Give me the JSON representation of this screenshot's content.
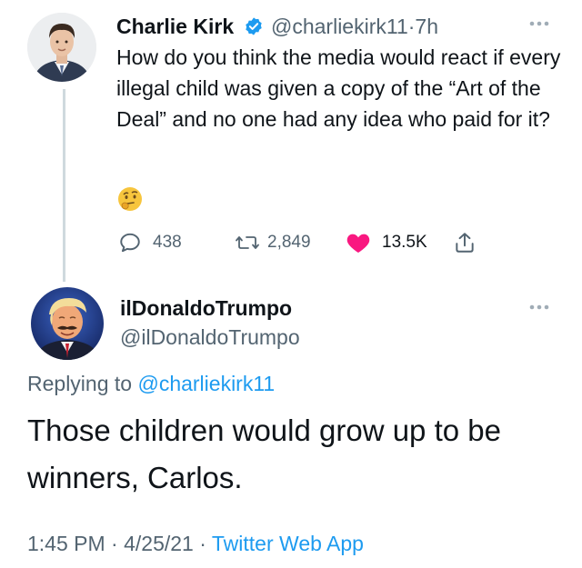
{
  "parent_tweet": {
    "author_name": "Charlie Kirk",
    "author_handle": "@charliekirk11",
    "time_separator": "·",
    "time_ago": "7h",
    "text": "How do you think the media would react if every illegal child was given a copy of the “Art of the Deal” and no one had any idea who paid for it?",
    "emoji_icon": "thinking-face-emoji",
    "replies_count": "438",
    "retweets_count": "2,849",
    "likes_count": "13.5K",
    "liked": true,
    "verified": true
  },
  "reply_tweet": {
    "author_name": "ilDonaldoTrumpo",
    "author_handle": "@ilDonaldoTrumpo",
    "replying_to_prefix": "Replying to",
    "replying_to_handle": "@charliekirk11",
    "text": "Those children would grow up to be winners, Carlos.",
    "time": "1:45 PM",
    "separator": "·",
    "date": "4/25/21",
    "source": "Twitter Web App"
  },
  "colors": {
    "link": "#1d9bf0",
    "secondary_text": "#536471",
    "like_heart": "#f91880",
    "primary_text": "#0f1419"
  }
}
